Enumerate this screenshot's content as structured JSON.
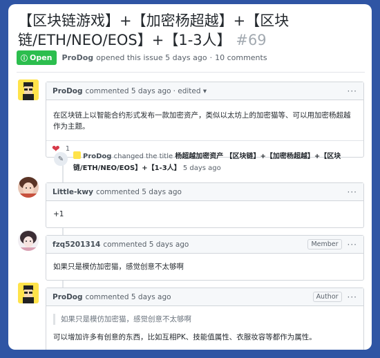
{
  "issue": {
    "title": "【区块链游戏】+【加密杨超越】+【区块链/ETH/NEO/EOS】+【1-3人】",
    "number": "#69",
    "state": "Open",
    "author": "ProDog",
    "opened_text": "opened this issue 5 days ago",
    "separator": "·",
    "comment_count": "10 comments"
  },
  "comments": [
    {
      "author": "ProDog",
      "action": "commented 5 days ago",
      "edited": "· edited ▾",
      "role": "",
      "body": "在区块链上以智能合约形式发布一款加密资产，类似以太坊上的加密猫等、可以用加密杨超越作为主题。",
      "reaction_count": "1"
    },
    {
      "author": "Little-kwy",
      "action": "commented 5 days ago",
      "role": "",
      "body": "+1"
    },
    {
      "author": "fzq5201314",
      "action": "commented 5 days ago",
      "role": "Member",
      "body": "如果只是模仿加密猫，感觉创意不太够啊"
    },
    {
      "author": "ProDog",
      "action": "commented 5 days ago",
      "role": "Author",
      "quote": "如果只是模仿加密猫，感觉创意不太够啊",
      "body": "可以增加许多有创意的东西，比如互相PK、技能值属性、衣服妆容等都作为属性。"
    }
  ],
  "event": {
    "actor": "ProDog",
    "action": "changed the title",
    "old_title": "杨超越加密资产",
    "new_title": "【区块链】+【加密杨超越】+【区块链/ETH/NEO/EOS】+【1-3人】",
    "time": "5 days ago"
  },
  "colors": {
    "frame_border": "#2f55a4",
    "open_badge": "#2cbe4e",
    "heart": "#d73a49"
  },
  "icons": {
    "open": "circle-exclamation-icon",
    "menu": "ellipsis-icon",
    "event": "pencil-icon",
    "reaction": "heart-icon"
  }
}
